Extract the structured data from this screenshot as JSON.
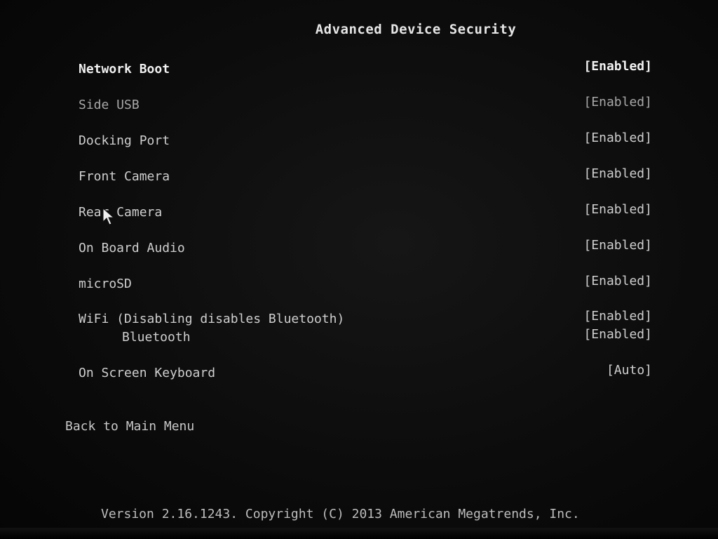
{
  "page": {
    "title": "Advanced Device Security"
  },
  "settings": [
    {
      "label": "Network Boot",
      "value": "[Enabled]"
    },
    {
      "label": "Side USB",
      "value": "[Enabled]"
    },
    {
      "label": "Docking Port",
      "value": "[Enabled]"
    },
    {
      "label": "Front Camera",
      "value": "[Enabled]"
    },
    {
      "label": "Rear Camera",
      "value": "[Enabled]"
    },
    {
      "label": "On Board Audio",
      "value": "[Enabled]"
    },
    {
      "label": "microSD",
      "value": "[Enabled]"
    },
    {
      "label": "WiFi (Disabling disables Bluetooth)",
      "value": "[Enabled]"
    },
    {
      "label": "Bluetooth",
      "value": "[Enabled]"
    },
    {
      "label": "On Screen Keyboard",
      "value": "[Auto]"
    }
  ],
  "navigation": {
    "back_label": "Back to Main Menu"
  },
  "footer": {
    "text": "Version 2.16.1243. Copyright (C) 2013 American Megatrends, Inc."
  },
  "icons": {
    "pointer": "mouse-pointer-icon"
  },
  "colors": {
    "background": "#0b0b0b",
    "text": "#cfcfcf",
    "selected_text": "#f2f2f2"
  }
}
